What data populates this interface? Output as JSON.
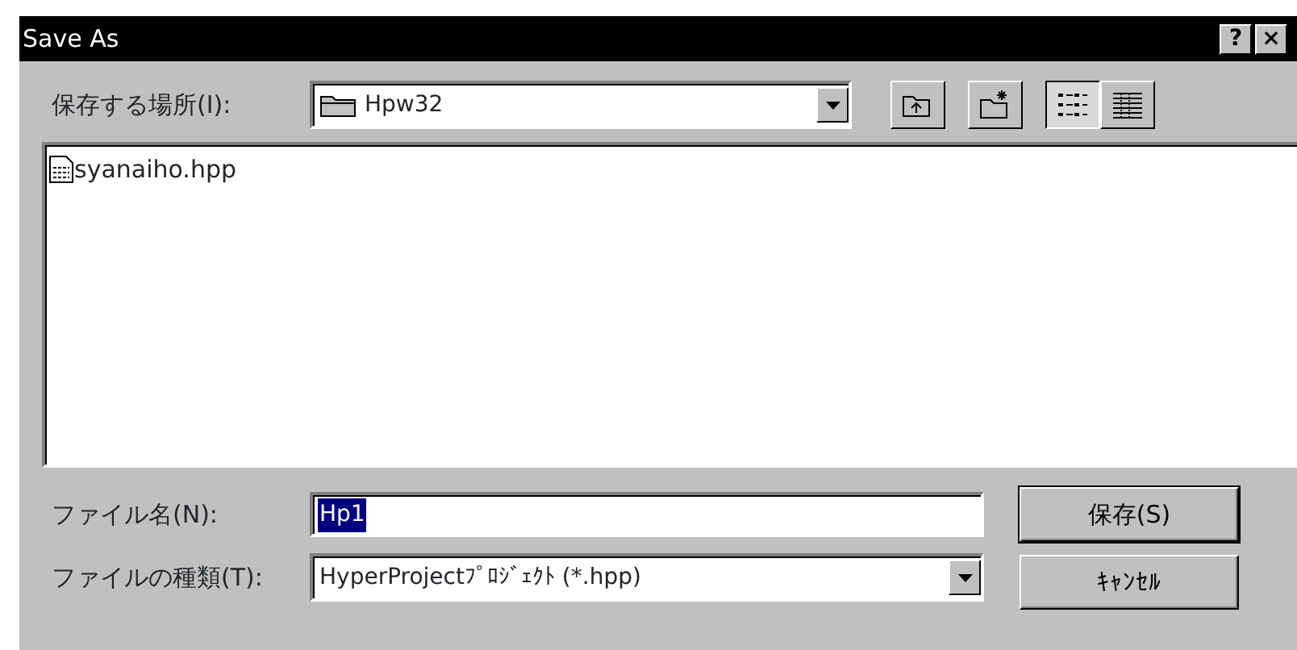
{
  "window": {
    "title": "Save As",
    "title_buttons": [
      "?",
      "×"
    ]
  },
  "location": {
    "label": "保存する場所(I):",
    "value": "Hpw32"
  },
  "toolbar": [
    {
      "kind": "up"
    },
    {
      "kind": "new-folder"
    },
    {
      "kind": "list",
      "selected": true
    },
    {
      "kind": "details",
      "selected": false
    }
  ],
  "files": [
    {
      "name": "syanaiho.hpp",
      "selected": false
    }
  ],
  "filename": {
    "label": "ファイル名(N):",
    "value": "Hp1"
  },
  "filetype": {
    "label": "ファイルの種類(T):",
    "value": "HyperProjectﾌﾟﾛｼﾞｪｸﾄ (*.hpp)"
  },
  "buttons": [
    {
      "label": "保存(S)",
      "default": true
    },
    {
      "label": "ｷｬﾝｾﾙ",
      "default": false
    }
  ]
}
